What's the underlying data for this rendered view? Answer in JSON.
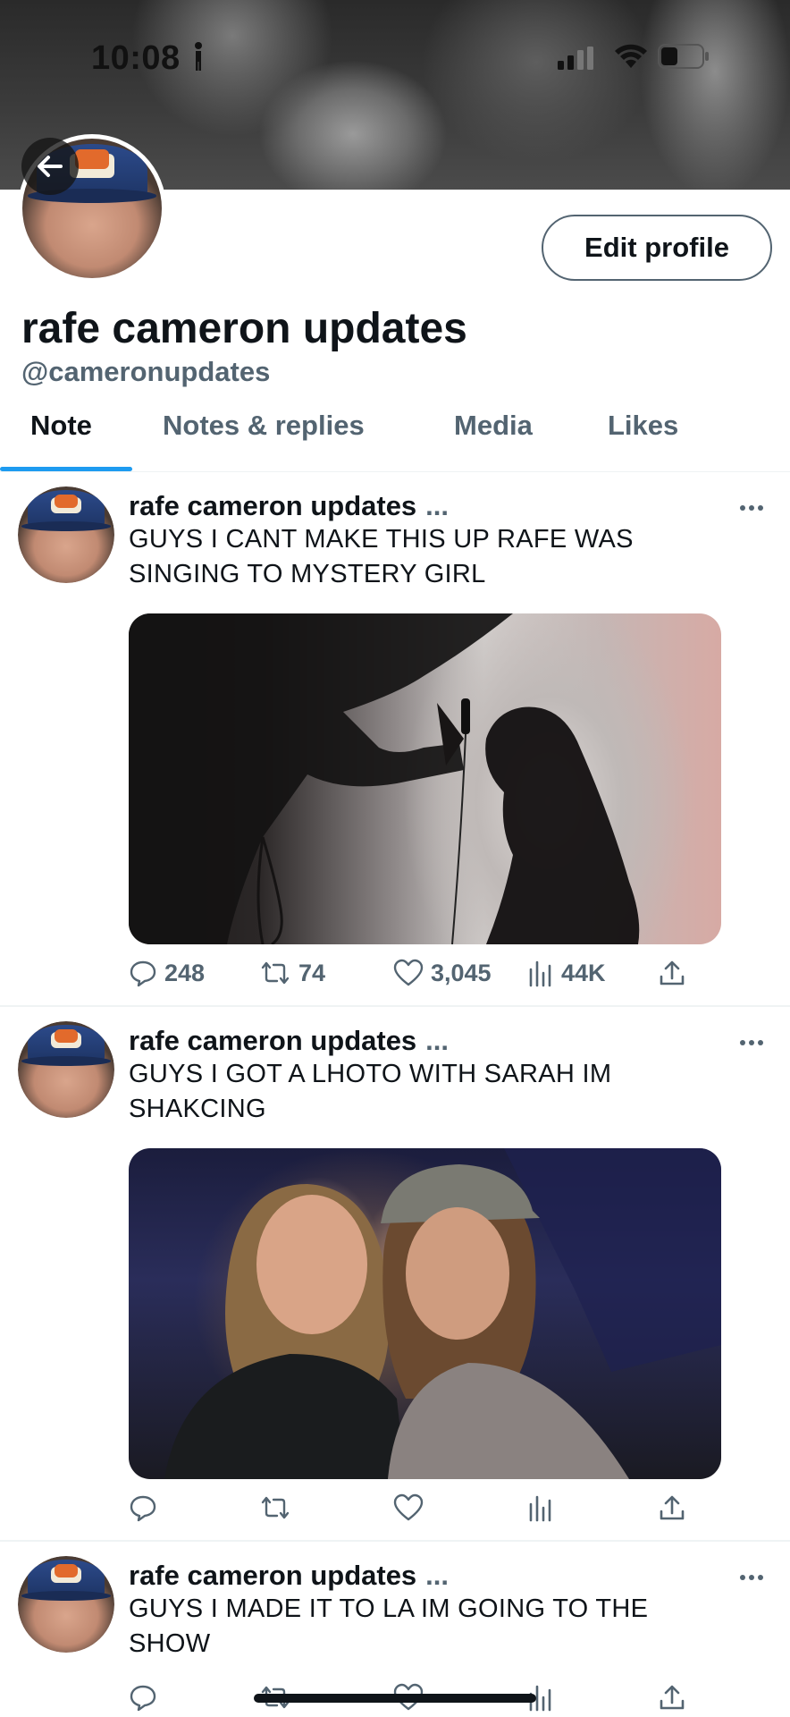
{
  "status_bar": {
    "time": "10:08"
  },
  "profile": {
    "display_name": "rafe cameron updates",
    "handle": "@cameronupdates",
    "edit_button": "Edit profile"
  },
  "tabs": [
    {
      "label": "Note",
      "active": true
    },
    {
      "label": "Notes & replies",
      "active": false
    },
    {
      "label": "Media",
      "active": false
    },
    {
      "label": "Likes",
      "active": false
    }
  ],
  "posts": [
    {
      "author": "rafe cameron updates",
      "dots": "...",
      "text_line1": "GUYS I CANT MAKE THIS UP RAFE WAS",
      "text_line2": "SINGING TO MYSTERY GIRL",
      "replies": "248",
      "reposts": "74",
      "likes": "3,045",
      "views": "44K"
    },
    {
      "author": "rafe cameron updates",
      "dots": "...",
      "text_line1": "GUYS I GOT A LHOTO WITH SARAH IM",
      "text_line2": "SHAKCING"
    },
    {
      "author": "rafe cameron updates",
      "dots": "...",
      "text_line1": "GUYS I MADE IT TO LA IM GOING TO THE",
      "text_line2": "SHOW"
    }
  ],
  "colors": {
    "accent": "#1d9bf0",
    "secondary_text": "#536471",
    "primary_text": "#0f1419"
  }
}
